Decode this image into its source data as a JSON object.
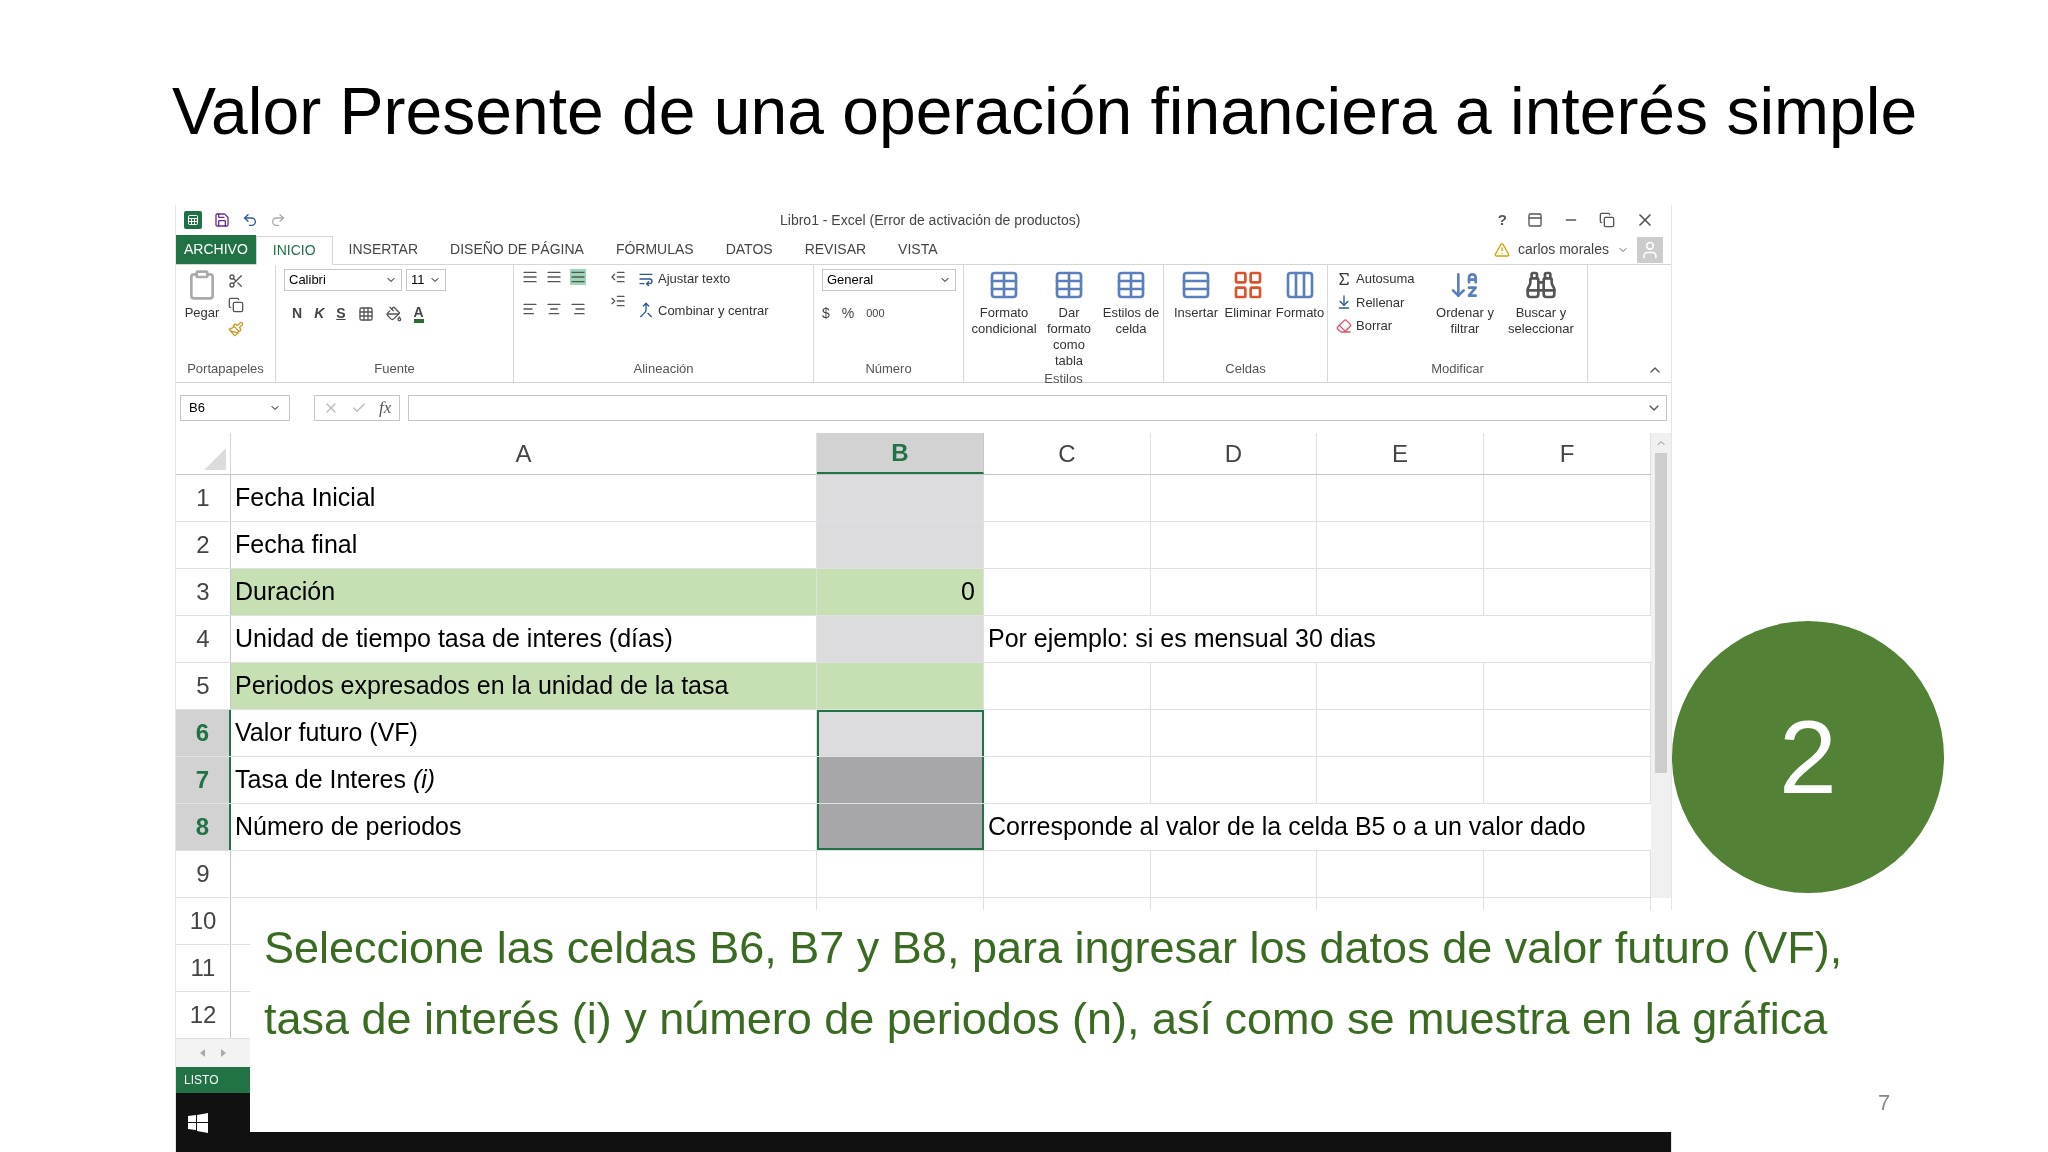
{
  "slide": {
    "title": "Valor Presente de una operación financiera a interés simple",
    "callout": "2",
    "caption": "Seleccione las celdas B6, B7 y B8, para ingresar los datos de valor futuro (VF), tasa de interés (i) y número de periodos (n), así como se muestra en la gráfica",
    "page_number": "7"
  },
  "excel": {
    "window_title": "Libro1 - Excel (Error de activación de productos)",
    "help": "?",
    "file_tab": "ARCHIVO",
    "tabs": [
      {
        "label": "INICIO",
        "selected": true
      },
      {
        "label": "INSERTAR",
        "selected": false
      },
      {
        "label": "DISEÑO DE PÁGINA",
        "selected": false
      },
      {
        "label": "FÓRMULAS",
        "selected": false
      },
      {
        "label": "DATOS",
        "selected": false
      },
      {
        "label": "REVISAR",
        "selected": false
      },
      {
        "label": "VISTA",
        "selected": false
      }
    ],
    "user": "carlos morales",
    "ribbon": {
      "clipboard": {
        "paste": "Pegar",
        "group": "Portapapeles"
      },
      "font": {
        "name": "Calibri",
        "size": "11",
        "bold": "N",
        "italic": "K",
        "underline": "S",
        "color_letter": "A",
        "group": "Fuente"
      },
      "alignment": {
        "wrap": "Ajustar texto",
        "merge": "Combinar y centrar",
        "group": "Alineación"
      },
      "number": {
        "format": "General",
        "currency": "$",
        "percent": "%",
        "thousands": "000",
        "group": "Número"
      },
      "styles": {
        "buttons": [
          "Formato condicional",
          "Dar formato como tabla",
          "Estilos de celda"
        ],
        "group": "Estilos"
      },
      "cells": {
        "buttons": [
          "Insertar",
          "Eliminar",
          "Formato"
        ],
        "group": "Celdas"
      },
      "editing": {
        "small": [
          "Autosuma",
          "Rellenar",
          "Borrar"
        ],
        "buttons": [
          "Ordenar y filtrar",
          "Buscar y seleccionar"
        ],
        "group": "Modificar"
      }
    },
    "name_box": "B6",
    "columns": [
      {
        "label": "A",
        "selected": false
      },
      {
        "label": "B",
        "selected": true
      },
      {
        "label": "C",
        "selected": false
      },
      {
        "label": "D",
        "selected": false
      },
      {
        "label": "E",
        "selected": false
      },
      {
        "label": "F",
        "selected": false
      }
    ],
    "function_symbol": "fx",
    "rows": [
      {
        "number": "1",
        "selected": false,
        "cells": [
          {
            "text": "Fecha Inicial",
            "color": "#ffffff"
          },
          {
            "color": "#dcdbdd"
          }
        ]
      },
      {
        "number": "2",
        "selected": false,
        "cells": [
          {
            "text": "Fecha final",
            "color": "#ffffff"
          },
          {
            "color": "#dcdbdd"
          }
        ]
      },
      {
        "number": "3",
        "selected": false,
        "cells": [
          {
            "text": "Duración",
            "color": "#c6e0b4"
          },
          {
            "text": "0",
            "color": "#c6e0b4"
          }
        ]
      },
      {
        "number": "4",
        "selected": false,
        "cells": [
          {
            "text": "Unidad de tiempo tasa de interes (días)",
            "color": "#ffffff"
          },
          {
            "color": "#dcdbdd"
          },
          {
            "text": "Por ejemplo: si es mensual 30 dias"
          }
        ]
      },
      {
        "number": "5",
        "selected": false,
        "cells": [
          {
            "text": "Periodos expresados en la unidad de la tasa",
            "color": "#c6e0b4"
          },
          {
            "color": "#c6e0b4"
          }
        ]
      },
      {
        "number": "6",
        "selected": true,
        "cells": [
          {
            "text": "Valor futuro (VF)",
            "color": "#ffffff"
          },
          {
            "color": "#dcdbdd"
          }
        ]
      },
      {
        "number": "7",
        "selected": true,
        "cells": [
          {
            "text": "Tasa de Interes *(i)*",
            "color": "#ffffff"
          },
          {
            "color": "#a7a6a8"
          }
        ]
      },
      {
        "number": "8",
        "selected": true,
        "cells": [
          {
            "text": "Número de periodos",
            "color": "#ffffff"
          },
          {
            "color": "#a7a6a8"
          },
          {
            "text": "Corresponde al valor de la celda B5 o a un valor dado"
          }
        ]
      },
      {
        "number": "9",
        "selected": false
      },
      {
        "number": "10",
        "selected": false
      },
      {
        "number": "11",
        "selected": false
      },
      {
        "number": "12",
        "selected": false
      }
    ],
    "status": "LISTO"
  }
}
